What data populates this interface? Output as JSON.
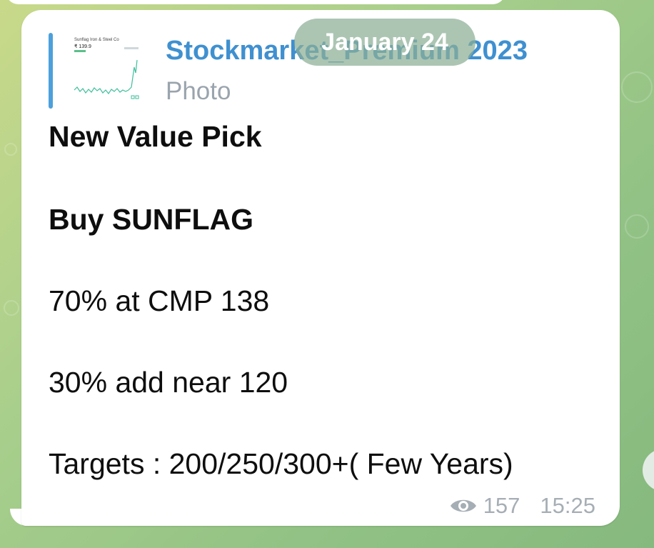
{
  "date_separator": "January 24",
  "message": {
    "reply": {
      "channel_name": "Stockmarket_Premium 2023",
      "media_type": "Photo",
      "thumbnail": {
        "title": "Sunflag Iron & Steel Co",
        "price": "₹ 139.9"
      }
    },
    "lines": [
      "New Value Pick",
      "Buy SUNFLAG",
      "70% at CMP 138",
      "30% add near 120",
      "Targets : 200/250/300+( Few Years)"
    ],
    "views": "157",
    "time": "15:25"
  },
  "colors": {
    "accent": "#4ca0dc",
    "channel_name": "#3f90d0",
    "meta_text": "#a6aeb5",
    "bubble": "#ffffff"
  },
  "icons": {
    "views": "eye-icon"
  }
}
